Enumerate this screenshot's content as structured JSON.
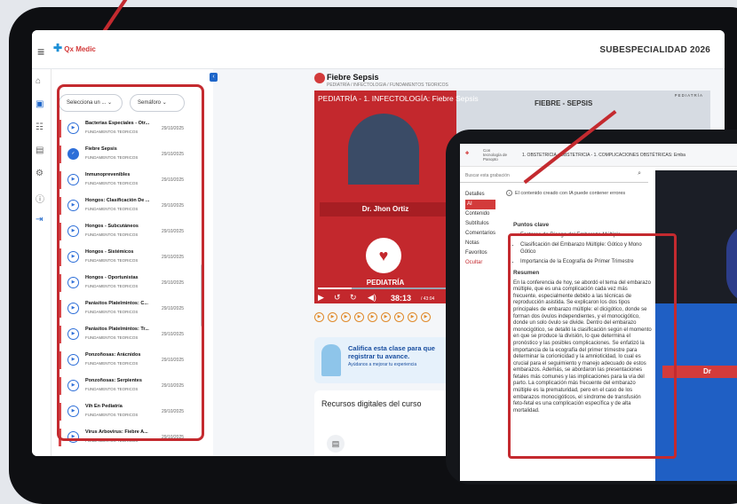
{
  "header": {
    "logo": "Qx Medic",
    "specialty": "SUBESPECIALIDAD 2026"
  },
  "filters": {
    "select_label": "Selecciona un ...",
    "semaforo_label": "Semáforo"
  },
  "lessons": [
    {
      "title": "Bacterias Especiales - Otr...",
      "sub": "FUNDAMENTOS TEORICOS",
      "date": "29/10/2025",
      "status": "play"
    },
    {
      "title": "Fiebre Sepsis",
      "sub": "FUNDAMENTOS TEORICOS",
      "date": "29/10/2025",
      "status": "done"
    },
    {
      "title": "Inmunoprevenibles",
      "sub": "FUNDAMENTOS TEORICOS",
      "date": "29/10/2025",
      "status": "play"
    },
    {
      "title": "Hongos: Clasificación De ...",
      "sub": "FUNDAMENTOS TEORICOS",
      "date": "29/10/2025",
      "status": "play"
    },
    {
      "title": "Hongos - Subcutáneos",
      "sub": "FUNDAMENTOS TEORICOS",
      "date": "29/10/2025",
      "status": "play"
    },
    {
      "title": "Hongos - Sistémicos",
      "sub": "FUNDAMENTOS TEORICOS",
      "date": "29/10/2025",
      "status": "play"
    },
    {
      "title": "Hongos - Oportunistas",
      "sub": "FUNDAMENTOS TEORICOS",
      "date": "29/10/2025",
      "status": "play"
    },
    {
      "title": "Parásitos Platelmintos: C...",
      "sub": "FUNDAMENTOS TEORICOS",
      "date": "29/10/2025",
      "status": "play"
    },
    {
      "title": "Parásitos Platelmintos: Tr...",
      "sub": "FUNDAMENTOS TEORICOS",
      "date": "29/10/2025",
      "status": "play"
    },
    {
      "title": "Ponzoñosas: Arácnidos",
      "sub": "FUNDAMENTOS TEORICOS",
      "date": "29/10/2025",
      "status": "play"
    },
    {
      "title": "Ponzoñosas: Serpientes",
      "sub": "FUNDAMENTOS TEORICOS",
      "date": "29/10/2025",
      "status": "play"
    },
    {
      "title": "Vih En Pediatría",
      "sub": "FUNDAMENTOS TEORICOS",
      "date": "29/10/2025",
      "status": "play"
    },
    {
      "title": "Virus Arbovirus: Fiebre A...",
      "sub": "FUNDAMENTOS TEORICOS",
      "date": "29/10/2025",
      "status": "play"
    }
  ],
  "video": {
    "title": "Fiebre Sepsis",
    "breadcrumb": "PEDIATRÍA / INFECTOLOGIA / FUNDAMENTOS TEORICOS",
    "overlay_title": "PEDIATRÍA - 1. INFECTOLOGÍA: Fiebre Sepsis",
    "slide_title": "FIEBRE - SEPSIS",
    "slide_tag": "PEDIATRÍA",
    "sepsis_tag": "SEPSIS",
    "doctor": "Dr. Jhon Ortiz",
    "specialty": "PEDIATRÍA",
    "time": "38:13",
    "duration": "/ 43:04",
    "progress": 0.2
  },
  "rate": {
    "heading": "Califica esta clase para que registrar tu avance.",
    "sub": "Ayúdanos a mejorar tu experiencia"
  },
  "resources": {
    "heading": "Recursos digitales del curso"
  },
  "tablet2": {
    "tech": "Con tecnología de Panopto",
    "breadcrumb": "1. OBSTETRICIA  ›  OBSTETRICIA - 1. COMPLICACIONES OBSTÉTRICAS: Emba",
    "search_placeholder": "Buscar esta grabación",
    "nav": [
      "Detalles",
      "AI Summary",
      "Contenido",
      "Subtítulos",
      "Comentarios",
      "Notas",
      "Favoritos",
      "Ocultar"
    ],
    "warning": "El contenido creado con IA puede contener errores",
    "key_points_title": "Puntos clave",
    "key_points": [
      "Factores de Riesgo del Embarazo Múltiple",
      "Clasificación del Embarazo Múltiple: Gótico y Mono Gótico",
      "Importancia de la Ecografía de Primer Trimestre"
    ],
    "summary_title": "Resumen",
    "summary": "En la conferencia de hoy, se abordó el tema del embarazo múltiple, que es una complicación cada vez más frecuente, especialmente debido a las técnicas de reproducción asistida. Se explicaron los dos tipos principales de embarazo múltiple: el dicigótico, donde se forman dos óvulos independientes, y el monocigótico, donde un solo óvulo se divide. Dentro del embarazo monocigótico, se detalló la clasificación según el momento en que se produce la división, lo que determina el pronóstico y las posibles complicaciones. Se enfatizó la importancia de la ecografía del primer trimestre para determinar la corionicidad y la amnioticidad, lo cual es crucial para el seguimiento y manejo adecuado de estos embarazos. Además, se abordaron las presentaciones fetales más comunes y las implicaciones para la vía del parto. La complicación más frecuente del embarazo múltiple es la prematuridad, pero en el caso de los embarazos monocigóticos, el síndrome de transfusión feto-fetal es una complicación específica y de alta mortalidad.",
    "video_name": "Dr"
  }
}
